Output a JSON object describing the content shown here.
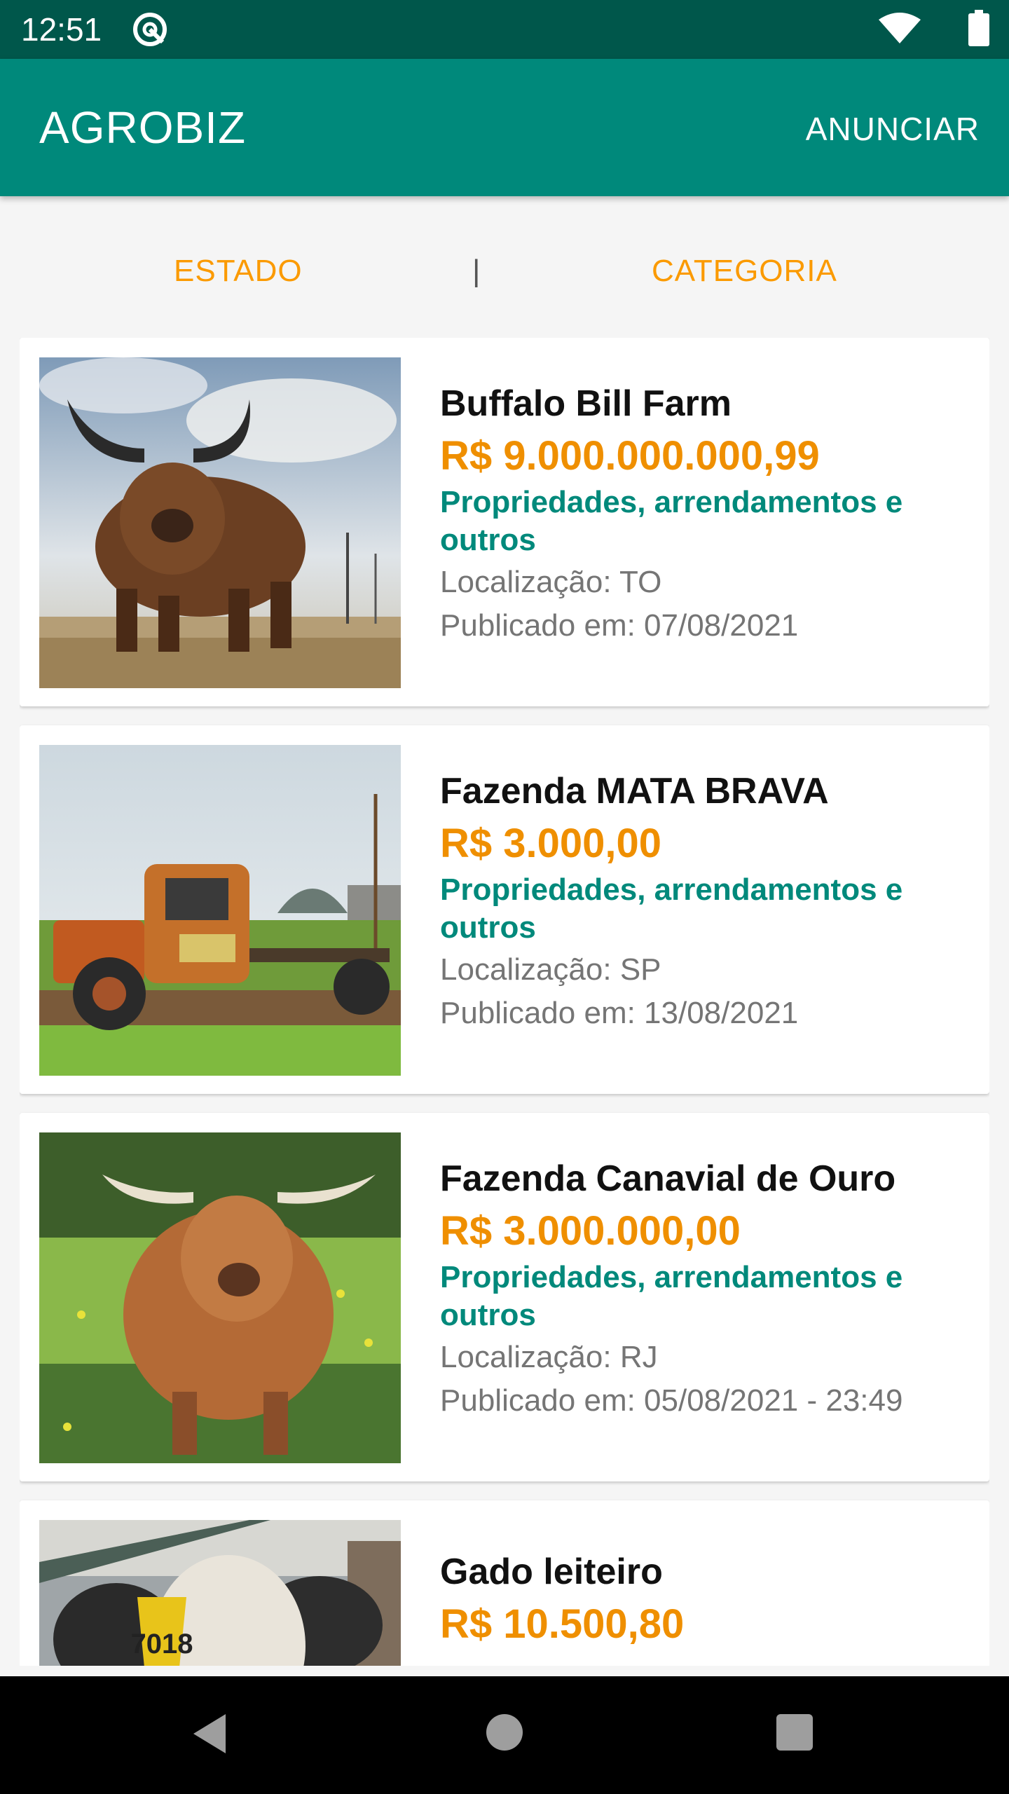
{
  "status_bar": {
    "time": "12:51",
    "icons": [
      "app-notification-icon",
      "wifi-icon",
      "battery-icon"
    ]
  },
  "app_bar": {
    "title": "AGROBIZ",
    "action_label": "ANUNCIAR",
    "color": "#00897b"
  },
  "filters": {
    "state_label": "ESTADO",
    "separator": "|",
    "category_label": "CATEGORIA",
    "color": "#fb9a00"
  },
  "listings": [
    {
      "title": "Buffalo Bill Farm",
      "price": "R$ 9.000.000.000,99",
      "category": "Propriedades, arrendamentos e outros",
      "location": "Localização: TO",
      "published": "Publicado em: 07/08/2021",
      "image": "highland-bull-photo"
    },
    {
      "title": "Fazenda MATA BRAVA",
      "price": "R$ 3.000,00",
      "category": "Propriedades, arrendamentos e outros",
      "location": "Localização: SP",
      "published": "Publicado em: 13/08/2021",
      "image": "rusty-truck-photo"
    },
    {
      "title": "Fazenda Canavial de Ouro",
      "price": "R$ 3.000.000,00",
      "category": "Propriedades, arrendamentos e outros",
      "location": "Localização: RJ",
      "published": "Publicado em: 05/08/2021 - 23:49",
      "image": "highland-cow-photo"
    },
    {
      "title": "Gado leiteiro",
      "price": "R$ 10.500,80",
      "image": "dairy-cow-photo",
      "image_tag_text": "7018"
    }
  ],
  "colors": {
    "price": "#ef8f00",
    "category": "#00897b",
    "meta": "#757575"
  },
  "nav_bar": {
    "icons": [
      "back-icon",
      "home-icon",
      "recents-icon"
    ]
  }
}
